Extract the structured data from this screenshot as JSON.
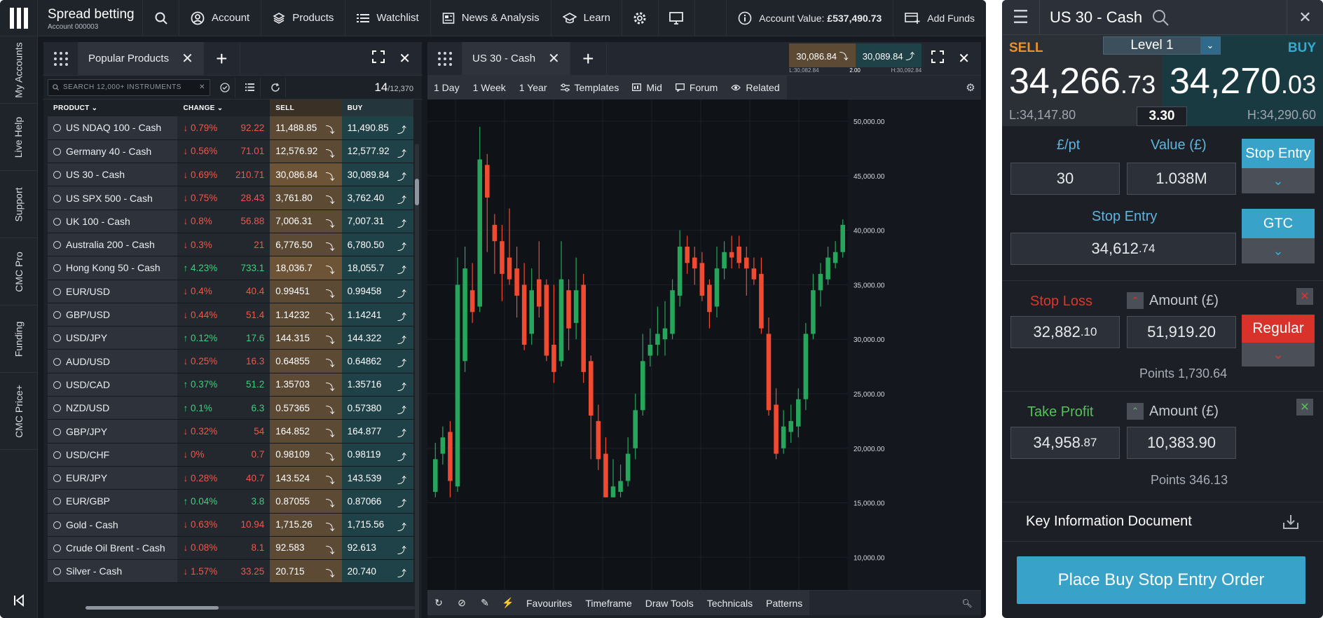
{
  "topbar": {
    "brand_title": "Spread betting",
    "brand_account": "Account 000003",
    "account_label": "Account",
    "products_label": "Products",
    "watchlist_label": "Watchlist",
    "news_label": "News & Analysis",
    "learn_label": "Learn",
    "account_value_label": "Account Value:",
    "account_value": "£537,490.73",
    "add_funds_label": "Add Funds"
  },
  "leftnav": [
    "My Accounts",
    "Live Help",
    "Support",
    "CMC Pro",
    "Funding",
    "CMC Price+"
  ],
  "products_panel": {
    "tab_label": "Popular Products",
    "search_placeholder": "SEARCH 12,000+ INSTRUMENTS",
    "count_shown": "14",
    "count_total": "12,370",
    "columns": [
      "PRODUCT",
      "CHANGE",
      "SELL",
      "BUY"
    ],
    "rows": [
      {
        "name": "US NDAQ 100 - Cash",
        "dir": "down",
        "pct": "0.79%",
        "abs": "92.22",
        "sell": "11,488.85",
        "buy": "11,490.85"
      },
      {
        "name": "Germany 40 - Cash",
        "dir": "down",
        "pct": "0.56%",
        "abs": "71.01",
        "sell": "12,576.92",
        "buy": "12,577.92"
      },
      {
        "name": "US 30 - Cash",
        "dir": "down",
        "pct": "0.69%",
        "abs": "210.71",
        "sell": "30,086.84",
        "buy": "30,089.84"
      },
      {
        "name": "US SPX 500 - Cash",
        "dir": "down",
        "pct": "0.75%",
        "abs": "28.43",
        "sell": "3,761.80",
        "buy": "3,762.40"
      },
      {
        "name": "UK 100 - Cash",
        "dir": "down",
        "pct": "0.8%",
        "abs": "56.88",
        "sell": "7,006.31",
        "buy": "7,007.31"
      },
      {
        "name": "Australia 200 - Cash",
        "dir": "down",
        "pct": "0.3%",
        "abs": "21",
        "sell": "6,776.50",
        "buy": "6,780.50"
      },
      {
        "name": "Hong Kong 50 - Cash",
        "dir": "up",
        "pct": "4.23%",
        "abs": "733.1",
        "sell": "18,036.7",
        "buy": "18,055.7"
      },
      {
        "name": "EUR/USD",
        "dir": "down",
        "pct": "0.4%",
        "abs": "40.4",
        "sell": "0.99451",
        "buy": "0.99458"
      },
      {
        "name": "GBP/USD",
        "dir": "down",
        "pct": "0.44%",
        "abs": "51.4",
        "sell": "1.14232",
        "buy": "1.14241"
      },
      {
        "name": "USD/JPY",
        "dir": "up",
        "pct": "0.12%",
        "abs": "17.6",
        "sell": "144.315",
        "buy": "144.322"
      },
      {
        "name": "AUD/USD",
        "dir": "down",
        "pct": "0.25%",
        "abs": "16.3",
        "sell": "0.64855",
        "buy": "0.64862"
      },
      {
        "name": "USD/CAD",
        "dir": "up",
        "pct": "0.37%",
        "abs": "51.2",
        "sell": "1.35703",
        "buy": "1.35716"
      },
      {
        "name": "NZD/USD",
        "dir": "up",
        "pct": "0.1%",
        "abs": "6.3",
        "sell": "0.57365",
        "buy": "0.57380"
      },
      {
        "name": "GBP/JPY",
        "dir": "down",
        "pct": "0.32%",
        "abs": "54",
        "sell": "164.852",
        "buy": "164.877"
      },
      {
        "name": "USD/CHF",
        "dir": "down",
        "pct": "0%",
        "abs": "0.7",
        "sell": "0.98109",
        "buy": "0.98119"
      },
      {
        "name": "EUR/JPY",
        "dir": "down",
        "pct": "0.28%",
        "abs": "40.7",
        "sell": "143.524",
        "buy": "143.539"
      },
      {
        "name": "EUR/GBP",
        "dir": "up",
        "pct": "0.04%",
        "abs": "3.8",
        "sell": "0.87055",
        "buy": "0.87066"
      },
      {
        "name": "Gold - Cash",
        "dir": "down",
        "pct": "0.63%",
        "abs": "10.94",
        "sell": "1,715.26",
        "buy": "1,715.56"
      },
      {
        "name": "Crude Oil Brent - Cash",
        "dir": "down",
        "pct": "0.08%",
        "abs": "8.1",
        "sell": "92.583",
        "buy": "92.613"
      },
      {
        "name": "Silver - Cash",
        "dir": "down",
        "pct": "1.57%",
        "abs": "33.25",
        "sell": "20.715",
        "buy": "20.740"
      }
    ]
  },
  "chart_panel": {
    "tab_label": "US 30 - Cash",
    "mini_sell": "30,086.84",
    "mini_buy": "30,089.84",
    "mini_low": "L:30,082.84",
    "mini_spread": "2.00",
    "mini_high": "H:30,092.84",
    "timeframes": [
      "1 Day",
      "1 Week",
      "1 Year"
    ],
    "templates_label": "Templates",
    "mid_label": "Mid",
    "forum_label": "Forum",
    "related_label": "Related",
    "bottom_tools": [
      "Favourites",
      "Timeframe",
      "Draw Tools",
      "Technicals",
      "Patterns"
    ],
    "y_ticks": [
      "50,000.00",
      "45,000.00",
      "40,000.00",
      "35,000.00",
      "30,000.00",
      "25,000.00",
      "20,000.00",
      "15,000.00",
      "10,000.00"
    ]
  },
  "chart_data": {
    "type": "candlestick",
    "y_ticks": [
      50000,
      45000,
      40000,
      35000,
      30000,
      25000,
      20000,
      15000,
      10000
    ],
    "candles": [
      {
        "o": 16000,
        "c": 19000,
        "h": 20500,
        "l": 15500
      },
      {
        "o": 19500,
        "c": 21000,
        "h": 22000,
        "l": 18500
      },
      {
        "o": 21500,
        "c": 17000,
        "h": 22500,
        "l": 15500
      },
      {
        "o": 16500,
        "c": 35000,
        "h": 37500,
        "l": 16000
      },
      {
        "o": 28000,
        "c": 36500,
        "h": 38500,
        "l": 27000
      },
      {
        "o": 34500,
        "c": 32500,
        "h": 37000,
        "l": 31500
      },
      {
        "o": 33000,
        "c": 46500,
        "h": 49500,
        "l": 32500
      },
      {
        "o": 46000,
        "c": 43000,
        "h": 47000,
        "l": 38000
      },
      {
        "o": 40500,
        "c": 39000,
        "h": 41500,
        "l": 36000
      },
      {
        "o": 39000,
        "c": 36000,
        "h": 40500,
        "l": 33500
      },
      {
        "o": 37500,
        "c": 35500,
        "h": 42000,
        "l": 35000
      },
      {
        "o": 36500,
        "c": 34000,
        "h": 38500,
        "l": 32000
      },
      {
        "o": 35000,
        "c": 29500,
        "h": 37000,
        "l": 29000
      },
      {
        "o": 30500,
        "c": 34500,
        "h": 36500,
        "l": 29500
      },
      {
        "o": 35500,
        "c": 33000,
        "h": 39000,
        "l": 32000
      },
      {
        "o": 35000,
        "c": 28500,
        "h": 35500,
        "l": 28000
      },
      {
        "o": 29500,
        "c": 27000,
        "h": 35000,
        "l": 26000
      },
      {
        "o": 28000,
        "c": 35500,
        "h": 39000,
        "l": 27500
      },
      {
        "o": 34500,
        "c": 31000,
        "h": 35500,
        "l": 29000
      },
      {
        "o": 31500,
        "c": 34500,
        "h": 37500,
        "l": 30000
      },
      {
        "o": 35000,
        "c": 27000,
        "h": 36000,
        "l": 26000
      },
      {
        "o": 28000,
        "c": 23000,
        "h": 28500,
        "l": 19000
      },
      {
        "o": 22500,
        "c": 19000,
        "h": 24000,
        "l": 18000
      },
      {
        "o": 19500,
        "c": 15500,
        "h": 21000,
        "l": 15500
      },
      {
        "o": 15500,
        "c": 16500,
        "h": 19000,
        "l": 15500
      },
      {
        "o": 16000,
        "c": 17000,
        "h": 18500,
        "l": 15500
      },
      {
        "o": 17000,
        "c": 19500,
        "h": 21000,
        "l": 16500
      },
      {
        "o": 20000,
        "c": 23500,
        "h": 25000,
        "l": 19000
      },
      {
        "o": 23500,
        "c": 28000,
        "h": 30500,
        "l": 23000
      },
      {
        "o": 28500,
        "c": 29500,
        "h": 31000,
        "l": 27500
      },
      {
        "o": 29500,
        "c": 30500,
        "h": 33000,
        "l": 28500
      },
      {
        "o": 30000,
        "c": 31000,
        "h": 33500,
        "l": 28500
      },
      {
        "o": 30500,
        "c": 34500,
        "h": 35500,
        "l": 30000
      },
      {
        "o": 34000,
        "c": 38500,
        "h": 40000,
        "l": 33000
      },
      {
        "o": 38500,
        "c": 37000,
        "h": 39500,
        "l": 36000
      },
      {
        "o": 37500,
        "c": 36500,
        "h": 38500,
        "l": 35000
      },
      {
        "o": 37000,
        "c": 34000,
        "h": 38000,
        "l": 33500
      },
      {
        "o": 35000,
        "c": 32500,
        "h": 35500,
        "l": 31000
      },
      {
        "o": 33000,
        "c": 36500,
        "h": 38500,
        "l": 32000
      },
      {
        "o": 36500,
        "c": 38000,
        "h": 39000,
        "l": 35500
      },
      {
        "o": 38000,
        "c": 37500,
        "h": 39500,
        "l": 36500
      },
      {
        "o": 38500,
        "c": 37000,
        "h": 39500,
        "l": 36500
      },
      {
        "o": 37500,
        "c": 36500,
        "h": 38500,
        "l": 34000
      },
      {
        "o": 36500,
        "c": 35500,
        "h": 37500,
        "l": 35000
      },
      {
        "o": 36000,
        "c": 31000,
        "h": 37500,
        "l": 30500
      },
      {
        "o": 30500,
        "c": 23500,
        "h": 32000,
        "l": 23000
      },
      {
        "o": 24000,
        "c": 19500,
        "h": 25500,
        "l": 19000
      },
      {
        "o": 20000,
        "c": 22000,
        "h": 23500,
        "l": 19500
      },
      {
        "o": 21500,
        "c": 22500,
        "h": 24000,
        "l": 20500
      },
      {
        "o": 22000,
        "c": 24500,
        "h": 25500,
        "l": 21000
      },
      {
        "o": 24500,
        "c": 30500,
        "h": 31500,
        "l": 23500
      },
      {
        "o": 30500,
        "c": 34500,
        "h": 36000,
        "l": 30000
      },
      {
        "o": 34500,
        "c": 36000,
        "h": 37000,
        "l": 33000
      },
      {
        "o": 35500,
        "c": 37500,
        "h": 38500,
        "l": 35000
      },
      {
        "o": 37000,
        "c": 38000,
        "h": 39000,
        "l": 36500
      },
      {
        "o": 38000,
        "c": 40500,
        "h": 41000,
        "l": 37500
      }
    ]
  },
  "ticket": {
    "title": "US 30 - Cash",
    "sell_label": "SELL",
    "buy_label": "BUY",
    "level_label": "Level 1",
    "sell_big": "34,266",
    "sell_small": ".73",
    "buy_big": "34,270",
    "buy_small": ".03",
    "low": "L:34,147.80",
    "high": "H:34,290.60",
    "spread": "3.30",
    "per_point_label": "£/pt",
    "value_label": "Value (£)",
    "per_point": "30",
    "value": "1.038M",
    "order_type": "Stop Entry",
    "stop_entry_label": "Stop Entry",
    "stop_entry_big": "34,612",
    "stop_entry_small": ".74",
    "gtc_label": "GTC",
    "stop_loss_label": "Stop Loss",
    "amount_label": "Amount (£)",
    "sl_price_big": "32,882",
    "sl_price_small": ".10",
    "sl_amount": "51,919.20",
    "regular_label": "Regular",
    "sl_points": "Points 1,730.64",
    "take_profit_label": "Take Profit",
    "tp_price_big": "34,958",
    "tp_price_small": ".87",
    "tp_amount": "10,383.90",
    "tp_points": "Points 346.13",
    "kid_label": "Key Information Document",
    "place_label": "Place Buy Stop Entry Order"
  },
  "colors": {
    "up": "#3fd07e",
    "down": "#f0574b",
    "candle_up": "#26a65b",
    "candle_down": "#f04a31",
    "accent": "#38a2c9"
  }
}
